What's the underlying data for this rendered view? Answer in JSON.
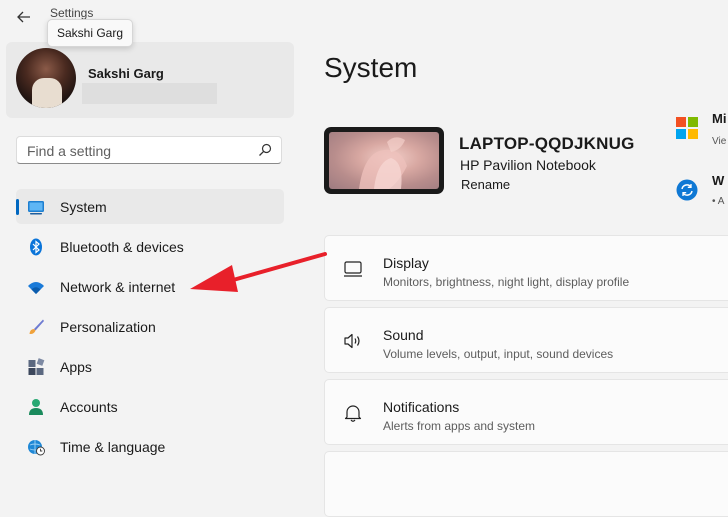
{
  "window": {
    "title": "Settings"
  },
  "tooltip": {
    "text": "Sakshi Garg"
  },
  "profile": {
    "name": "Sakshi Garg"
  },
  "search": {
    "placeholder": "Find a setting"
  },
  "nav": {
    "items": [
      {
        "label": "System",
        "icon": "system-icon",
        "active": true
      },
      {
        "label": "Bluetooth & devices",
        "icon": "bluetooth-icon"
      },
      {
        "label": "Network & internet",
        "icon": "wifi-icon"
      },
      {
        "label": "Personalization",
        "icon": "brush-icon"
      },
      {
        "label": "Apps",
        "icon": "apps-icon"
      },
      {
        "label": "Accounts",
        "icon": "account-icon"
      },
      {
        "label": "Time & language",
        "icon": "globe-clock-icon"
      }
    ]
  },
  "main": {
    "title": "System",
    "device": {
      "name": "LAPTOP-QQDJKNUG",
      "model": "HP Pavilion Notebook",
      "rename": "Rename"
    },
    "side": {
      "microsoft_label": "Mi",
      "microsoft_sub": "Vie",
      "update_label": "W",
      "update_sub": "• A"
    },
    "cards": [
      {
        "title": "Display",
        "subtitle": "Monitors, brightness, night light, display profile",
        "icon": "monitor-icon"
      },
      {
        "title": "Sound",
        "subtitle": "Volume levels, output, input, sound devices",
        "icon": "speaker-icon"
      },
      {
        "title": "Notifications",
        "subtitle": "Alerts from apps and system",
        "icon": "bell-icon"
      }
    ]
  },
  "colors": {
    "accent": "#0067c0",
    "annotation_arrow": "#e8202a"
  }
}
